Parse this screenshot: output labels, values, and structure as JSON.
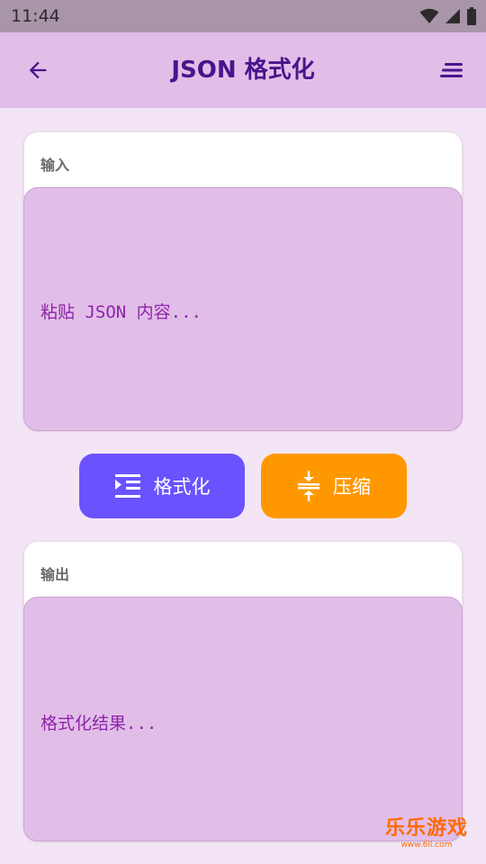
{
  "status_bar": {
    "time": "11:44",
    "icons": [
      "wifi-icon",
      "signal-icon",
      "battery-icon"
    ]
  },
  "app_bar": {
    "title": "JSON 格式化",
    "back_icon": "arrow-back-icon",
    "menu_icon": "sort-lines-icon"
  },
  "input_card": {
    "label": "输入",
    "placeholder": "粘贴 JSON 内容..."
  },
  "actions": {
    "format_label": "格式化",
    "format_icon": "indent-format-icon",
    "compress_label": "压缩",
    "compress_icon": "compress-vertical-icon"
  },
  "output_card": {
    "label": "输出",
    "placeholder": "格式化结果..."
  },
  "watermark": {
    "main": "乐乐游戏",
    "sub": "www.6ll.com"
  },
  "colors": {
    "app_bar": "#e1bee7",
    "background": "#f3e5f5",
    "title": "#4a148c",
    "format_button": "#6a52ff",
    "compress_button": "#ff9800",
    "placeholder": "#8e24aa"
  }
}
